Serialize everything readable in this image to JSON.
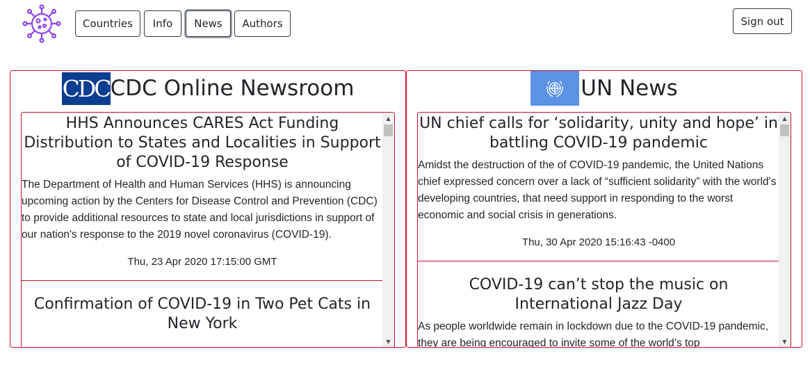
{
  "nav": {
    "buttons": [
      {
        "label": "Countries"
      },
      {
        "label": "Info"
      },
      {
        "label": "News"
      },
      {
        "label": "Authors"
      }
    ],
    "active": "News",
    "sign_out": "Sign out"
  },
  "colors": {
    "accent": "#c8102e",
    "cdc_blue": "#0b3d91",
    "un_blue": "#5b92e5",
    "logo_purple": "#8e44ef"
  },
  "panels": [
    {
      "title": "CDC Online Newsroom",
      "logo_text": "CDC",
      "articles": [
        {
          "title": "HHS Announces CARES Act Funding Distribution to States and Localities in Support of COVID-19 Response",
          "description": "The Department of Health and Human Services (HHS) is announcing upcoming action by the Centers for Disease Control and Prevention (CDC) to provide additional resources to state and local jurisdictions in support of our nation's response to the 2019 novel coronavirus (COVID-19).",
          "date": "Thu, 23 Apr 2020 17:15:00 GMT"
        },
        {
          "title": "Confirmation of COVID-19 in Two Pet Cats in New York",
          "description": "",
          "date": ""
        }
      ]
    },
    {
      "title": "UN News",
      "logo_icon": "un-emblem-icon",
      "articles": [
        {
          "title": "UN chief calls for ‘solidarity, unity and hope’ in battling COVID-19 pandemic",
          "description": "Amidst the destruction of the of COVID-19 pandemic, the United Nations chief expressed concern over a lack of “sufficient solidarity” with the world’s developing countries, that need support in responding to the worst economic and social crisis in generations.",
          "date": "Thu, 30 Apr 2020 15:16:43 -0400"
        },
        {
          "title": "COVID-19 can’t stop the music on International Jazz Day",
          "description": "As people worldwide remain in lockdown due to the COVID-19 pandemic, they are being encouraged to invite some of the world’s top",
          "date": ""
        }
      ]
    }
  ]
}
